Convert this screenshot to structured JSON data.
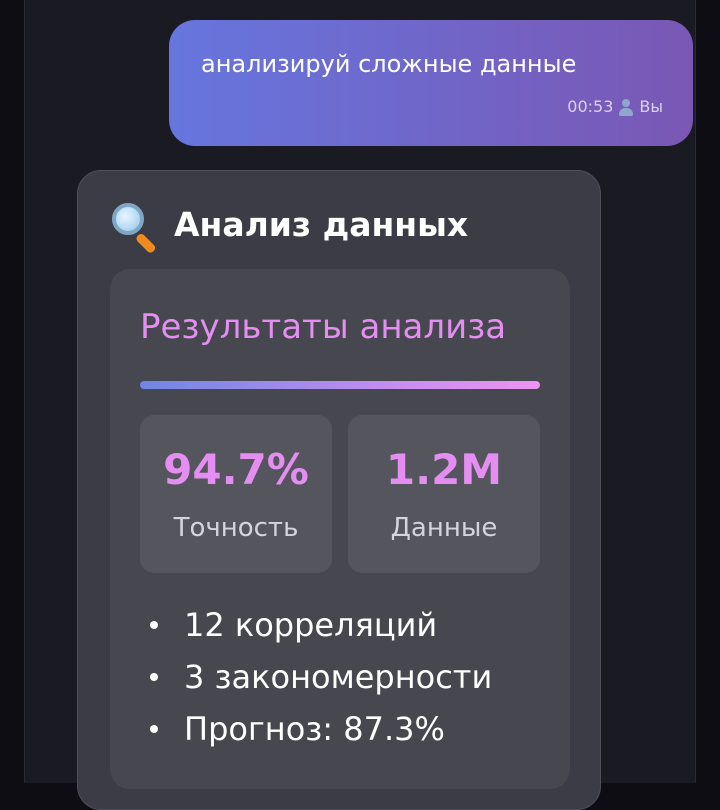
{
  "user_message": {
    "text": "анализируй сложные данные",
    "time": "00:53",
    "sender": "Вы",
    "sender_icon": "person-icon"
  },
  "bot_message": {
    "title": "Анализ данных",
    "title_icon": "magnifier-icon",
    "results": {
      "heading": "Результаты анализа",
      "stats": [
        {
          "value": "94.7%",
          "label": "Точность"
        },
        {
          "value": "1.2M",
          "label": "Данные"
        }
      ],
      "bullets": [
        "12 корреляций",
        "3 закономерности",
        "Прогноз: 87.3%"
      ]
    }
  },
  "colors": {
    "accent": "#e48ef2",
    "user_bubble_start": "#6676de",
    "user_bubble_end": "#7a57b4",
    "card_bg": "#3c3c47"
  }
}
